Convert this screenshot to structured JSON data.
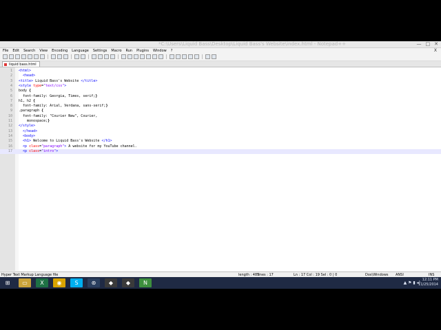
{
  "window": {
    "title": "*C:\\Users\\Liquid Bass\\Desktop\\Liquid Bass's Website\\index.html - Notepad++",
    "buttons": [
      "—",
      "□",
      "✕"
    ]
  },
  "menu": [
    "File",
    "Edit",
    "Search",
    "View",
    "Encoding",
    "Language",
    "Settings",
    "Macro",
    "Run",
    "Plugins",
    "Window",
    "?"
  ],
  "menu_close": "X",
  "tab": {
    "label": "liquid bass.html"
  },
  "editor": {
    "lines": [
      {
        "n": "1",
        "html": "<span class=\"tag\">&lt;html&gt;</span>"
      },
      {
        "n": "2",
        "html": "  <span class=\"tag\">&lt;head&gt;</span>"
      },
      {
        "n": "3",
        "html": "<span class=\"tag\">&lt;title&gt;</span> Liquid Bass's Website <span class=\"tag\">&lt;/title&gt;</span>"
      },
      {
        "n": "4",
        "html": "<span class=\"tag\">&lt;style</span> <span class=\"attr\">type</span>=<span class=\"str\">\"text/css\"</span><span class=\"tag\">&gt;</span>"
      },
      {
        "n": "5",
        "html": "body <span class=\"bold\">{</span>"
      },
      {
        "n": "6",
        "html": "  font-family: Georgia, Times, serif;<span class=\"bold\">}</span>"
      },
      {
        "n": "7",
        "html": "h1, h2 <span class=\"bold\">{</span>"
      },
      {
        "n": "8",
        "html": "  font-family: Arial, Verdana, sans-serif;<span class=\"bold\">}</span>"
      },
      {
        "n": "9",
        "html": ".paragraph <span class=\"bold\">{</span>"
      },
      {
        "n": "10",
        "html": "  font-family: \"Courier New\", Courier,"
      },
      {
        "n": "11",
        "html": "    monospace;<span class=\"bold\">}</span>"
      },
      {
        "n": "12",
        "html": "<span class=\"tag\">&lt;/style&gt;</span>"
      },
      {
        "n": "13",
        "html": "  <span class=\"tag\">&lt;/head&gt;</span>"
      },
      {
        "n": "14",
        "html": "  <span class=\"tag\">&lt;body&gt;</span>"
      },
      {
        "n": "15",
        "html": "  <span class=\"tag\">&lt;h1&gt;</span> Welcome to Liquid Bass's Website <span class=\"tag\">&lt;/h1&gt;</span>"
      },
      {
        "n": "16",
        "html": "  <span class=\"tag\">&lt;p</span> <span class=\"attr\">class</span>=<span class=\"str\">\"paragraph\"</span><span class=\"tag\">&gt;</span> A website for my YouTube channel."
      },
      {
        "n": "17",
        "html": "  <span class=\"tag\">&lt;p</span> <span class=\"attr\">class</span>=<span class=\"str\">\"intro\"</span><span class=\"tag\">&gt;</span>"
      }
    ],
    "current_line": 17
  },
  "status": {
    "language": "Hyper Text Markup Language file",
    "length": "length : 485",
    "lines": "lines : 17",
    "position": "Ln : 17   Col : 19   Sel : 0 | 0",
    "eol": "Dos\\Windows",
    "encoding": "ANSI",
    "mode": "INS"
  },
  "taskbar": {
    "clock_time": "12:11 PM",
    "clock_date": "11/25/2014",
    "apps": [
      {
        "name": "start-icon",
        "glyph": "⊞",
        "color": "#1f2a44"
      },
      {
        "name": "file-explorer-icon",
        "glyph": "▭",
        "color": "#c9a23a"
      },
      {
        "name": "excel-icon",
        "glyph": "X",
        "color": "#1e7145"
      },
      {
        "name": "chrome-icon",
        "glyph": "◉",
        "color": "#d9a400"
      },
      {
        "name": "skype-icon",
        "glyph": "S",
        "color": "#00aff0"
      },
      {
        "name": "steam-icon",
        "glyph": "⊛",
        "color": "#2a3f5f"
      },
      {
        "name": "app-icon",
        "glyph": "◆",
        "color": "#3a3a3a"
      },
      {
        "name": "app2-icon",
        "glyph": "◆",
        "color": "#3a3a3a"
      },
      {
        "name": "notepadpp-icon",
        "glyph": "N",
        "color": "#3d8f3d"
      }
    ],
    "tray": "▲ ⚑ ▮ ◂)"
  }
}
